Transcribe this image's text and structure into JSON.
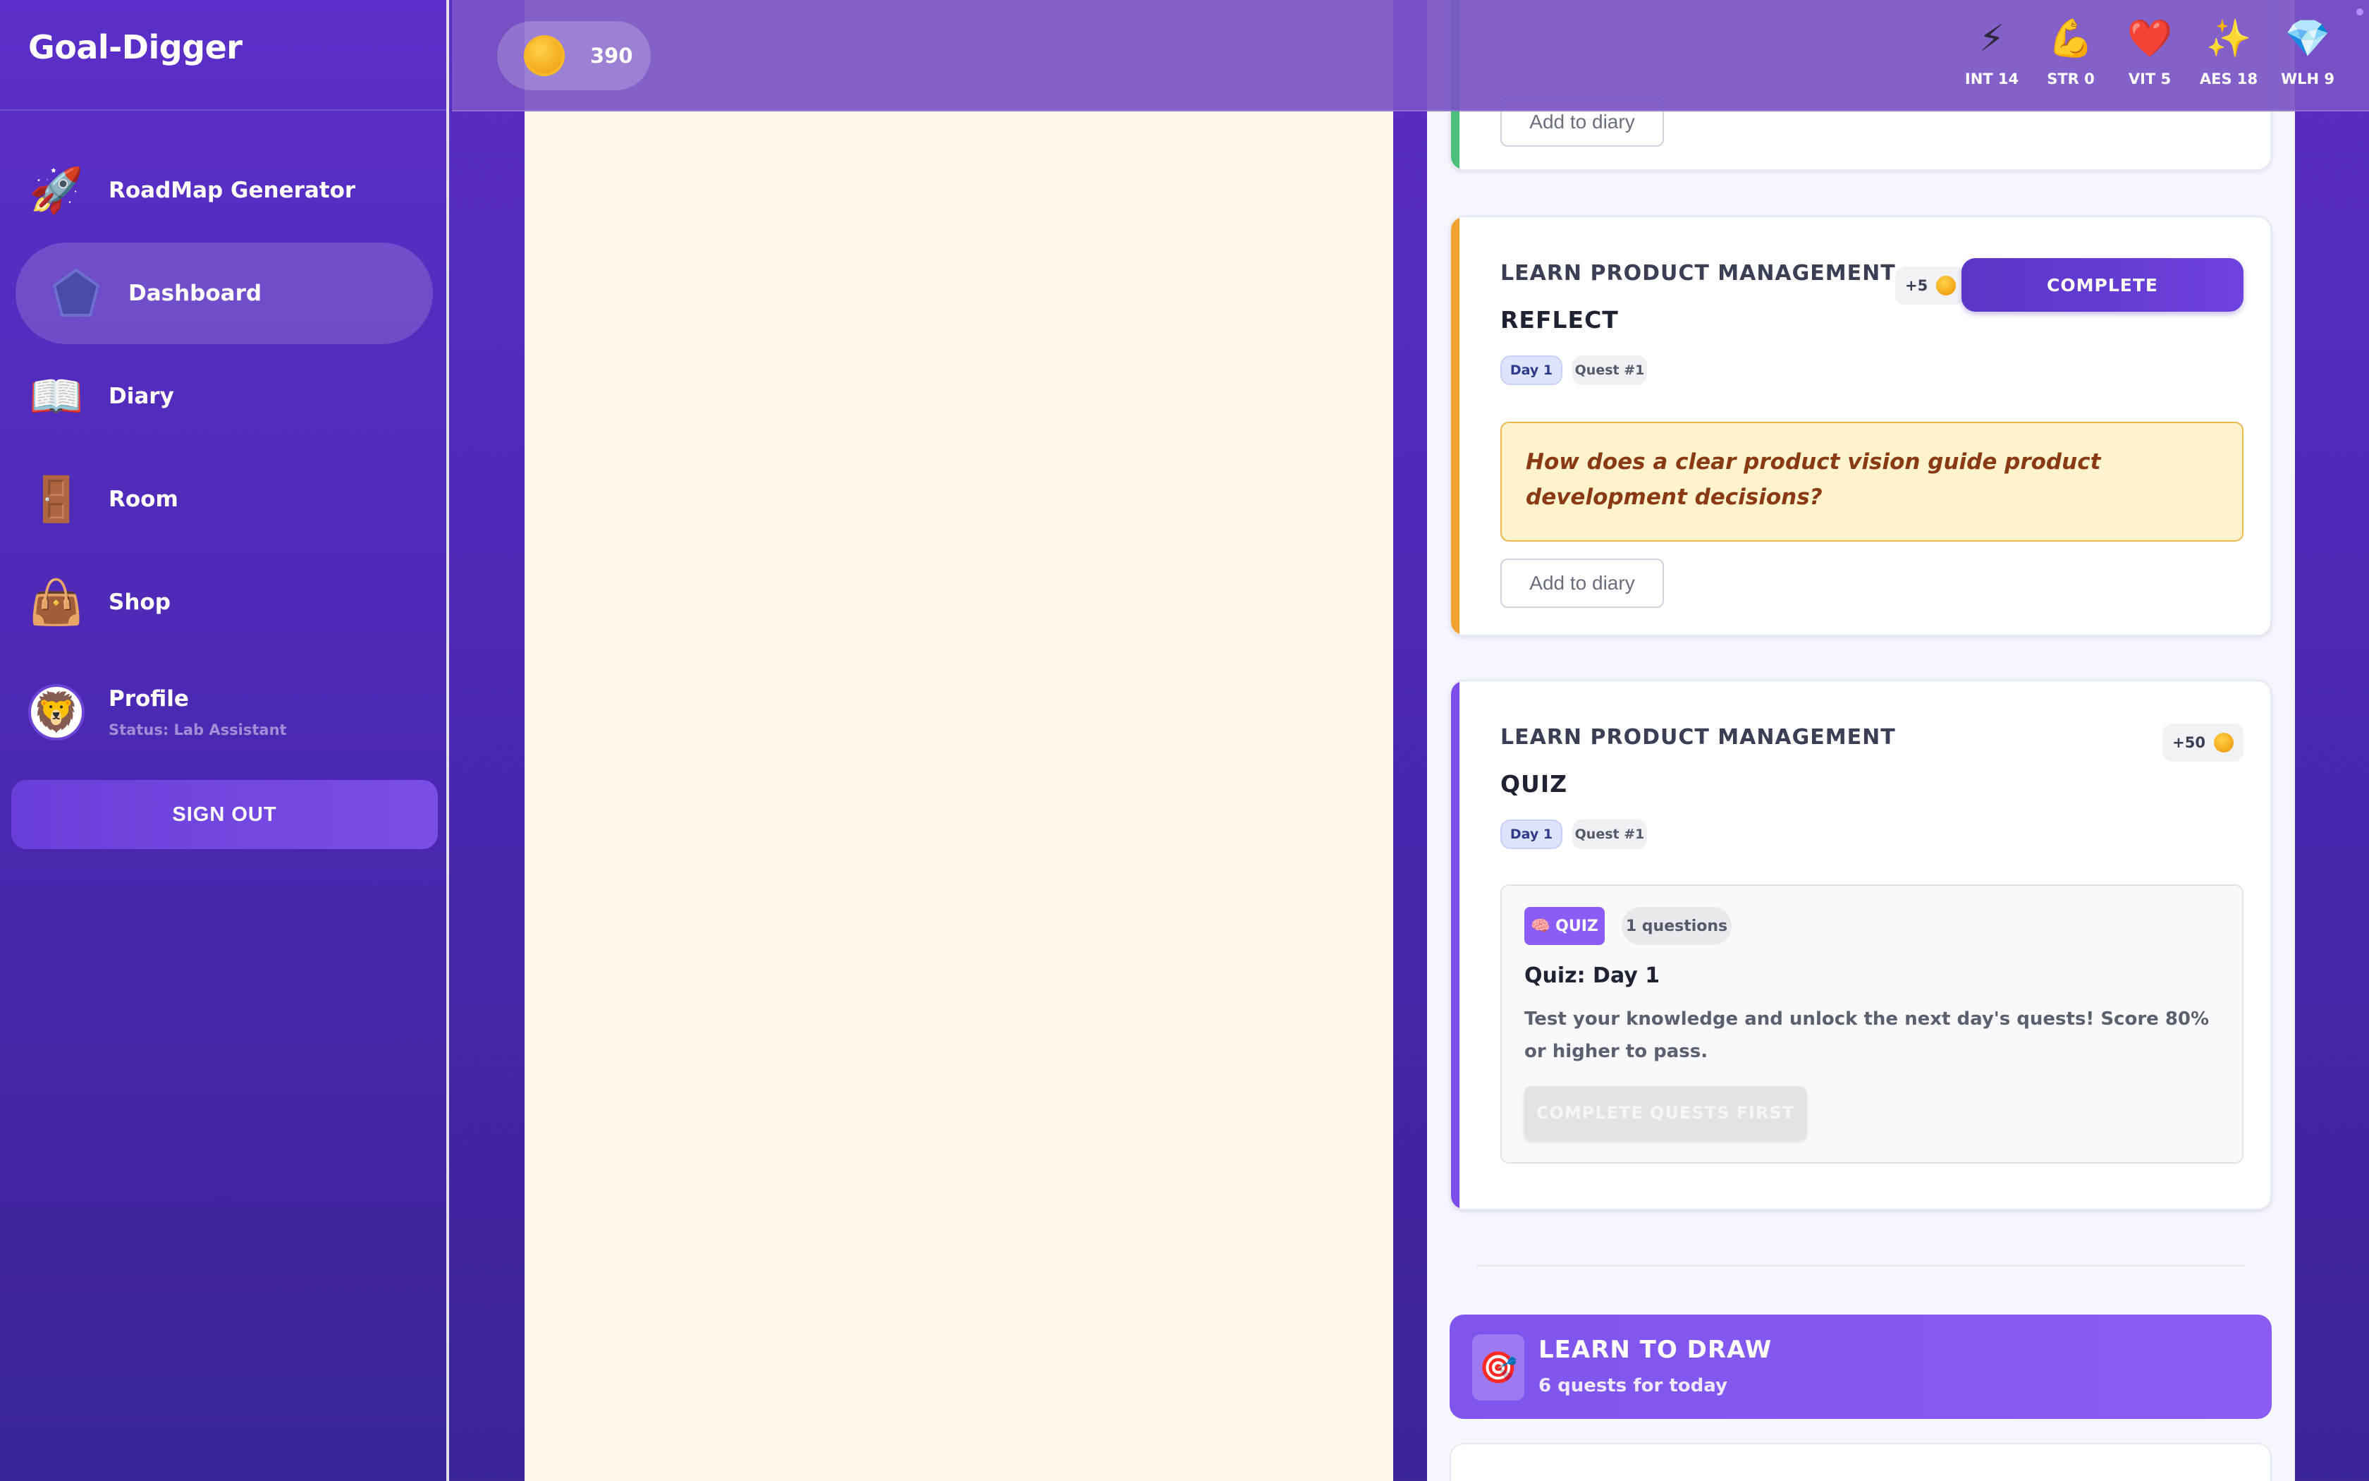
{
  "app": {
    "title": "Goal-Digger"
  },
  "sidebar": {
    "items": [
      {
        "label": "RoadMap Generator",
        "icon": "🚀"
      },
      {
        "label": "Dashboard",
        "icon": "⬟"
      },
      {
        "label": "Diary",
        "icon": "📖"
      },
      {
        "label": "Room",
        "icon": "🚪"
      },
      {
        "label": "Shop",
        "icon": "👜"
      }
    ],
    "profile": {
      "label": "Profile",
      "status": "Status: Lab Assistant",
      "avatar": "🦁"
    },
    "signout_label": "SIGN OUT"
  },
  "topbar": {
    "coins": "390",
    "stats": [
      {
        "icon": "⚡",
        "label": "INT 14"
      },
      {
        "icon": "💪",
        "label": "STR 0"
      },
      {
        "icon": "❤️",
        "label": "VIT 5"
      },
      {
        "icon": "✨",
        "label": "AES 18"
      },
      {
        "icon": "💎",
        "label": "WLH 9"
      }
    ]
  },
  "quests": {
    "partial_card": {
      "diary_label": "Add to diary",
      "stripe_color": "#4cbf7a"
    },
    "reflect_card": {
      "title": "LEARN PRODUCT MANAGEMENT",
      "type": "REFLECT",
      "day": "Day 1",
      "quest": "Quest #1",
      "reward": "+5",
      "complete_label": "COMPLETE",
      "prompt": "How does a clear product vision guide product development decisions?",
      "diary_label": "Add to diary",
      "stripe_color": "#f0a22e"
    },
    "quiz_card": {
      "title": "LEARN PRODUCT MANAGEMENT",
      "type": "QUIZ",
      "day": "Day 1",
      "quest": "Quest #1",
      "reward": "+50",
      "tag": "🧠 QUIZ",
      "count": "1 questions",
      "quiz_title": "Quiz: Day 1",
      "description": "Test your knowledge and unlock the next day's quests! Score 80% or higher to pass.",
      "locked_label": "COMPLETE QUESTS FIRST",
      "stripe_color": "#7c4ee8"
    },
    "section": {
      "title": "LEARN TO DRAW",
      "subtitle": "6 quests for today",
      "icon": "🎯"
    }
  }
}
